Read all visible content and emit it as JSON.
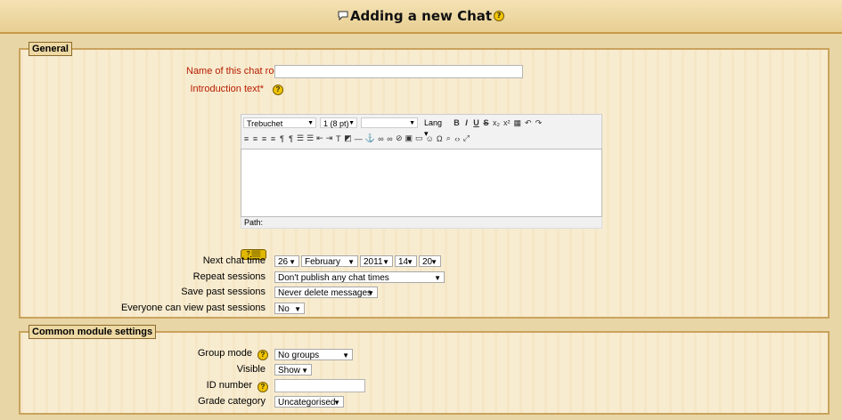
{
  "header": {
    "title": "Adding a new Chat"
  },
  "general": {
    "legend": "General",
    "name_label": "Name of this chat room*",
    "name_value": "",
    "intro_label": "Introduction text*",
    "editor": {
      "font": "Trebuchet",
      "size": "1 (8 pt)",
      "format": "",
      "lang": "Lang",
      "path_label": "Path:"
    },
    "next_chat_label": "Next chat time",
    "day": "26",
    "month": "February",
    "year": "2011",
    "hour": "14",
    "minute": "20",
    "repeat_label": "Repeat sessions",
    "repeat_value": "Don't publish any chat times",
    "save_label": "Save past sessions",
    "save_value": "Never delete messages",
    "everyone_label": "Everyone can view past sessions",
    "everyone_value": "No"
  },
  "common": {
    "legend": "Common module settings",
    "group_mode_label": "Group mode",
    "group_mode_value": "No groups",
    "visible_label": "Visible",
    "visible_value": "Show",
    "idnumber_label": "ID number",
    "idnumber_value": "",
    "grade_label": "Grade category",
    "grade_value": "Uncategorised"
  },
  "colors": {
    "background": "#e9d6a6",
    "panel": "#f8ecd0",
    "required": "#b81c00"
  },
  "icons": {
    "help": "help-icon",
    "chat": "chat-bubble-icon"
  }
}
